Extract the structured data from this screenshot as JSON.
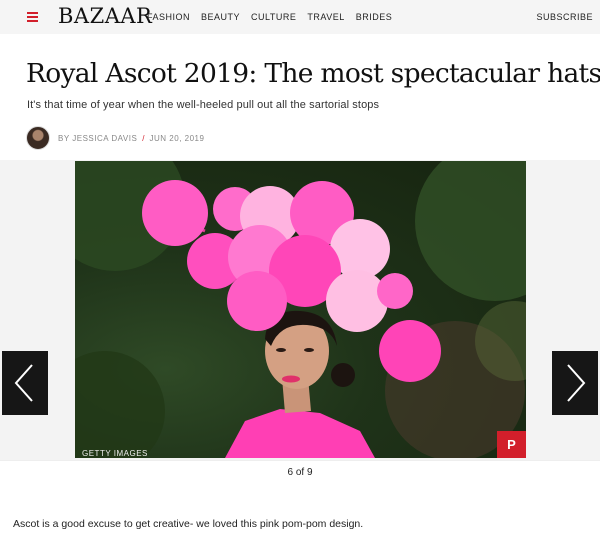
{
  "brand": {
    "logo": "BAZAAR",
    "accent": "#d21f2b"
  },
  "nav": {
    "menu_icon": "hamburger-icon",
    "links": [
      "FASHION",
      "BEAUTY",
      "CULTURE",
      "TRAVEL",
      "BRIDES"
    ],
    "subscribe": "SUBSCRIBE"
  },
  "article": {
    "title": "Royal Ascot 2019: The most spectacular hats",
    "dek": "It's that time of year when the well-heeled pull out all the sartorial stops",
    "byline": "BY JESSICA DAVIS",
    "separator": "/",
    "date": "JUN 20, 2019"
  },
  "gallery": {
    "credit": "GETTY IMAGES",
    "pinterest_icon": "pinterest-icon",
    "pinterest_glyph": "P",
    "prev_icon": "chevron-left-icon",
    "next_icon": "chevron-right-icon",
    "counter": "6 of 9",
    "caption": "Ascot is a good excuse to get creative- we loved this pink pom-pom design."
  }
}
